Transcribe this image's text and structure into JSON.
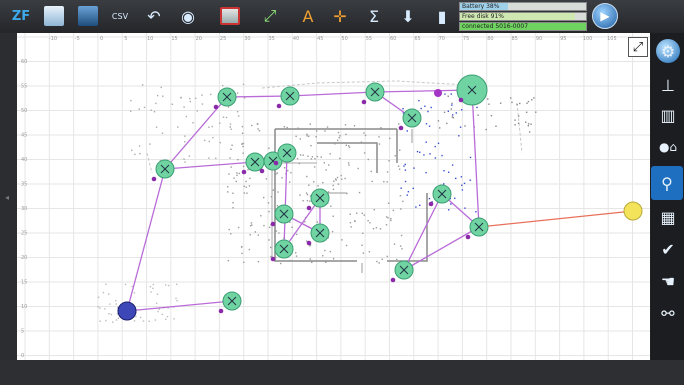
{
  "toolbar": {
    "logo": "ZF",
    "buttons": [
      {
        "name": "open-folder-icon",
        "glyph": "🗀"
      },
      {
        "name": "save-icon",
        "glyph": "■"
      },
      {
        "name": "csv-select-icon",
        "glyph": "CSV"
      },
      {
        "name": "undo-icon",
        "glyph": "↶"
      },
      {
        "name": "globe-icon",
        "glyph": "◉"
      },
      {
        "name": "screen-icon",
        "glyph": "▣"
      },
      {
        "name": "measure-icon",
        "glyph": "⤢"
      },
      {
        "name": "align-icon",
        "glyph": "A"
      },
      {
        "name": "center-icon",
        "glyph": "✛"
      },
      {
        "name": "sigma-icon",
        "glyph": "Σ"
      },
      {
        "name": "download-icon",
        "glyph": "⬇"
      },
      {
        "name": "robot-icon",
        "glyph": "▮"
      }
    ]
  },
  "status": {
    "battery_label": "Battery 38%",
    "battery_level": 0.38,
    "disk_label": "Free disk 91%",
    "disk_level": 0.91,
    "connection_label": "connected 5016-0007",
    "colors": {
      "battery": "#9fd0ea",
      "disk": "#cfe7b0",
      "connection": "#6fd35f"
    }
  },
  "grid": {
    "x_ticks": [
      "-10",
      "-5",
      "0",
      "5",
      "10",
      "15",
      "20",
      "25",
      "30",
      "35",
      "40",
      "45",
      "50",
      "55",
      "60",
      "65",
      "70",
      "75",
      "80",
      "85",
      "90",
      "95",
      "100",
      "105"
    ],
    "y_ticks": [
      "60",
      "55",
      "50",
      "45",
      "40",
      "35",
      "30",
      "25",
      "20",
      "15",
      "10",
      "5",
      "0"
    ]
  },
  "sidebar": {
    "items": [
      {
        "name": "settings-circle-icon",
        "glyph": "⚙"
      },
      {
        "name": "tag-icon",
        "glyph": "⊥"
      },
      {
        "name": "ruler-icon",
        "glyph": "▥"
      },
      {
        "name": "home-point-icon",
        "glyph": "●⌂"
      },
      {
        "name": "waypoint-pin-icon",
        "glyph": "⚲"
      },
      {
        "name": "map-select-icon",
        "glyph": "▦"
      },
      {
        "name": "map-check-icon",
        "glyph": "✔"
      },
      {
        "name": "map-hand-icon",
        "glyph": "☚"
      },
      {
        "name": "network-icon",
        "glyph": "⚯"
      }
    ]
  },
  "accents": {
    "route": "#b96bd8",
    "node": "#6fd3a2",
    "selected": "#3e47b8",
    "target": "#f2e35a",
    "active_bg": "#1e6fc0"
  }
}
